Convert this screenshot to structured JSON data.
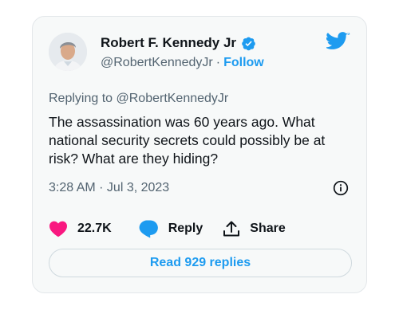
{
  "tweet": {
    "author": {
      "name": "Robert F. Kennedy Jr",
      "handle": "@RobertKennedyJr",
      "separator": "·",
      "follow_label": "Follow"
    },
    "replying_to": "Replying to @RobertKennedyJr",
    "text": "The assassination was 60 years ago. What national security secrets could possibly be at risk? What are they hiding?",
    "timestamp": "3:28 AM · Jul 3, 2023",
    "actions": {
      "like_count": "22.7K",
      "reply_label": "Reply",
      "share_label": "Share"
    },
    "read_replies_label": "Read 929 replies"
  },
  "icons": {
    "verified": "verified-badge-icon",
    "twitter": "twitter-bird-icon",
    "info": "info-icon",
    "like": "heart-icon",
    "reply": "speech-bubble-icon",
    "share": "share-upload-icon"
  },
  "colors": {
    "brand_blue": "#1d9bf0",
    "like_pink": "#f91880",
    "text_primary": "#0f1419",
    "text_secondary": "#536471",
    "card_background": "#f7f9f9"
  }
}
